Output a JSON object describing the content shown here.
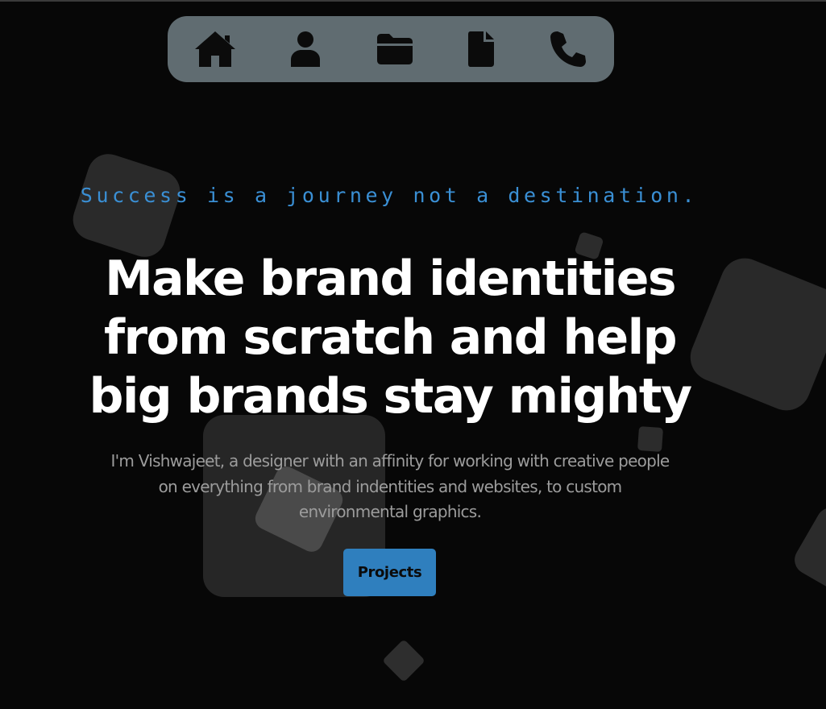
{
  "nav": {
    "items": [
      {
        "icon": "home-icon"
      },
      {
        "icon": "user-icon"
      },
      {
        "icon": "folder-icon"
      },
      {
        "icon": "document-icon"
      },
      {
        "icon": "phone-icon"
      }
    ],
    "background": "#606c71",
    "icon_color": "#0b0b0b"
  },
  "hero": {
    "quote": "Success is a journey not a destination.",
    "headline": [
      "Make brand identities",
      "from scratch and help",
      "big brands stay mighty"
    ],
    "intro": [
      "I'm Vishwajeet, a designer with an affinity for working with creative people",
      "on everything from brand indentities and websites, to custom",
      "environmental graphics."
    ],
    "button_label": "Projects"
  },
  "colors": {
    "page_background": "#070707",
    "accent": "#2f7fbe",
    "quote_color": "#3a8fd4",
    "headline_color": "#ffffff",
    "intro_color": "#9c9c9c"
  }
}
